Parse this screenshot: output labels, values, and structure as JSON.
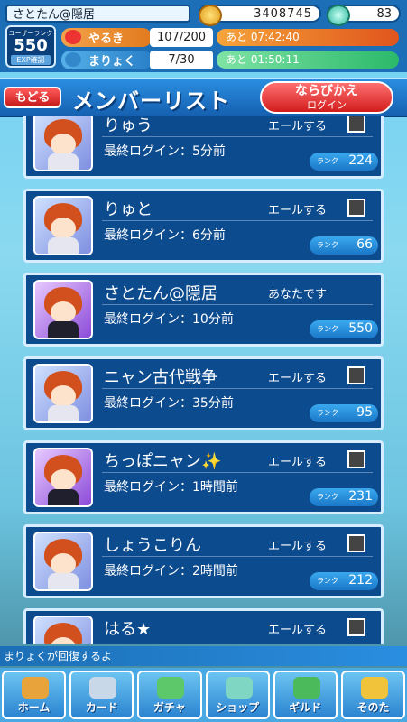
{
  "status": {
    "player_name": "さとたん@隠居",
    "coins": "3408745",
    "gems": "83",
    "user_rank_label": "ユーザーランク",
    "user_rank": "550",
    "exp_label": "EXP確認",
    "yaruki": {
      "label": "やるき",
      "count": "107/200",
      "timer": "あと 07:42:40"
    },
    "maryoku": {
      "label": "まりょく",
      "count": "7/30",
      "timer": "あと 01:50:11"
    }
  },
  "header": {
    "back_label": "もどる",
    "title": "メンバーリスト",
    "sort_label": "ならびかえ",
    "sort_sub": "ログイン"
  },
  "members": [
    {
      "name": "りゅう",
      "login": "最終ログイン：5分前",
      "cheer": "エールする",
      "rank_label": "ランク",
      "rank": "224"
    },
    {
      "name": "りゅと",
      "login": "最終ログイン：6分前",
      "cheer": "エールする",
      "rank_label": "ランク",
      "rank": "66"
    },
    {
      "name": "さとたん@隠居",
      "login": "最終ログイン：10分前",
      "cheer": "あなたです",
      "rank_label": "ランク",
      "rank": "550"
    },
    {
      "name": "ニャン古代戦争",
      "login": "最終ログイン：35分前",
      "cheer": "エールする",
      "rank_label": "ランク",
      "rank": "95"
    },
    {
      "name": "ちっぽニャン✨",
      "login": "最終ログイン：1時間前",
      "cheer": "エールする",
      "rank_label": "ランク",
      "rank": "231"
    },
    {
      "name": "しょうこりん",
      "login": "最終ログイン：2時間前",
      "cheer": "エールする",
      "rank_label": "ランク",
      "rank": "212"
    },
    {
      "name": "はる★",
      "cheer": "エールする"
    }
  ],
  "notice": "まりょくが回復するよ",
  "nav": [
    {
      "label": "ホーム",
      "color": "#e8a33a"
    },
    {
      "label": "カード",
      "color": "#c8d8e8"
    },
    {
      "label": "ガチャ",
      "color": "#5cc86a"
    },
    {
      "label": "ショップ",
      "color": "#7fd6c2"
    },
    {
      "label": "ギルド",
      "color": "#4aba5a"
    },
    {
      "label": "そのた",
      "color": "#f0c33a"
    }
  ]
}
